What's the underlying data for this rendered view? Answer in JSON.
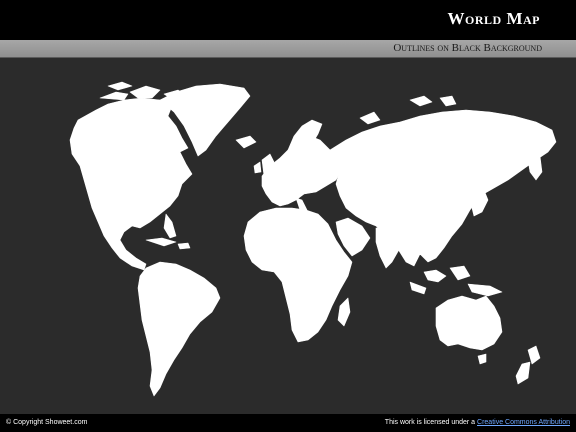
{
  "header": {
    "title": "World Map"
  },
  "subheader": {
    "subtitle": "Outlines on Black Background"
  },
  "map": {
    "land_color": "#ffffff",
    "ocean_color": "#2b2b2b",
    "regions": [
      "north-america",
      "greenland",
      "south-america",
      "europe",
      "africa",
      "asia",
      "australia",
      "new-zealand"
    ]
  },
  "footer": {
    "copyright": "© Copyright Showeet.com",
    "license_prefix": "This work is licensed under a ",
    "license_link": "Creative Commons Attribution"
  }
}
